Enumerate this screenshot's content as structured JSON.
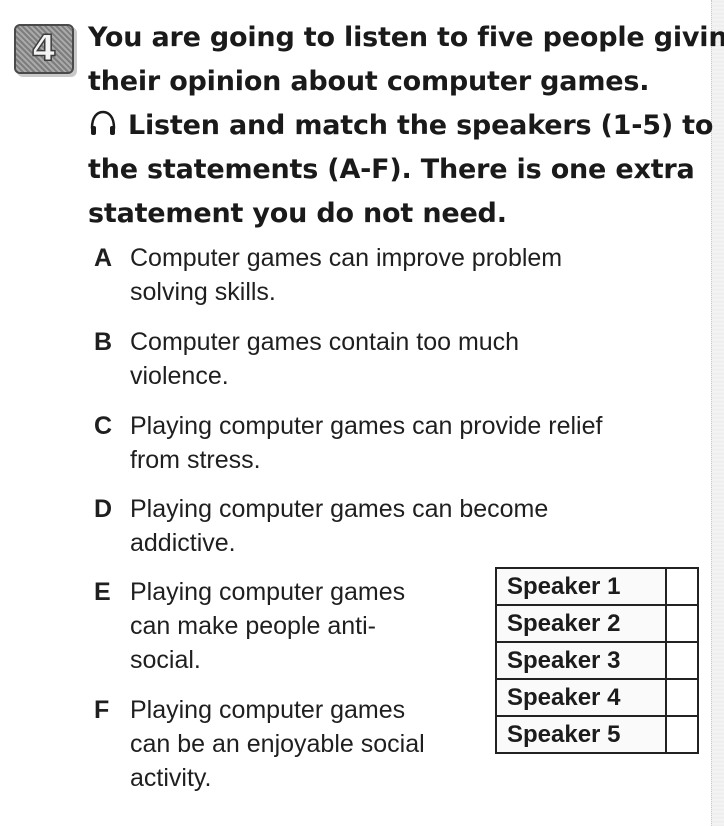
{
  "exercise": {
    "number": "4",
    "instruction_lines": [
      "You are going to listen to five people giving",
      "their opinion about computer games.",
      "Listen and match the speakers (1-5) to",
      "the statements (A-F). There is one extra",
      "statement you do not need."
    ],
    "listen_icon": "headphones-icon"
  },
  "statements": [
    {
      "letter": "A",
      "lines": [
        "Computer games can improve problem",
        "solving skills."
      ]
    },
    {
      "letter": "B",
      "lines": [
        "Computer games contain too much",
        "violence."
      ]
    },
    {
      "letter": "C",
      "lines": [
        "Playing computer games can provide relief",
        "from stress."
      ]
    },
    {
      "letter": "D",
      "lines": [
        "Playing computer games can become",
        "addictive."
      ]
    },
    {
      "letter": "E",
      "lines": [
        "Playing computer games",
        "can make people anti-",
        "social."
      ]
    },
    {
      "letter": "F",
      "lines": [
        "Playing computer games",
        "can be an enjoyable social",
        "activity."
      ]
    }
  ],
  "speakers": [
    {
      "label": "Speaker 1",
      "answer": ""
    },
    {
      "label": "Speaker 2",
      "answer": ""
    },
    {
      "label": "Speaker 3",
      "answer": ""
    },
    {
      "label": "Speaker 4",
      "answer": ""
    },
    {
      "label": "Speaker 5",
      "answer": ""
    }
  ]
}
